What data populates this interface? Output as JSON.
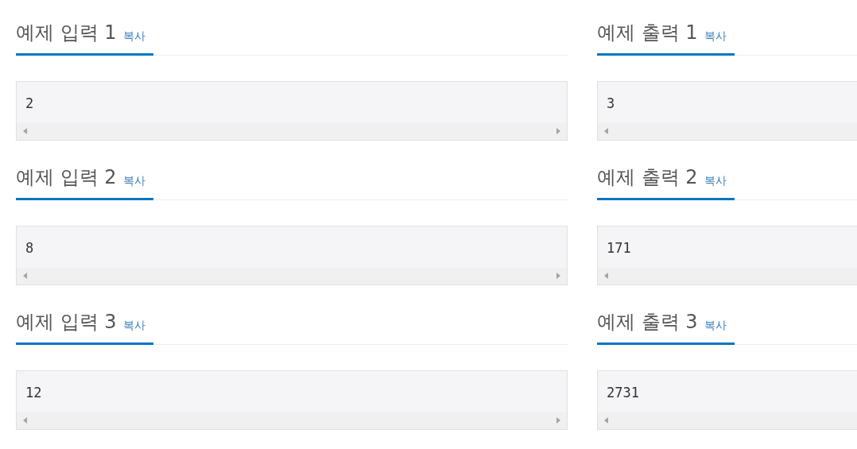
{
  "samples": [
    {
      "input": {
        "title": "예제 입력 1",
        "copy": "복사",
        "value": "2"
      },
      "output": {
        "title": "예제 출력 1",
        "copy": "복사",
        "value": "3"
      }
    },
    {
      "input": {
        "title": "예제 입력 2",
        "copy": "복사",
        "value": "8"
      },
      "output": {
        "title": "예제 출력 2",
        "copy": "복사",
        "value": "171"
      }
    },
    {
      "input": {
        "title": "예제 입력 3",
        "copy": "복사",
        "value": "12"
      },
      "output": {
        "title": "예제 출력 3",
        "copy": "복사",
        "value": "2731"
      }
    }
  ]
}
